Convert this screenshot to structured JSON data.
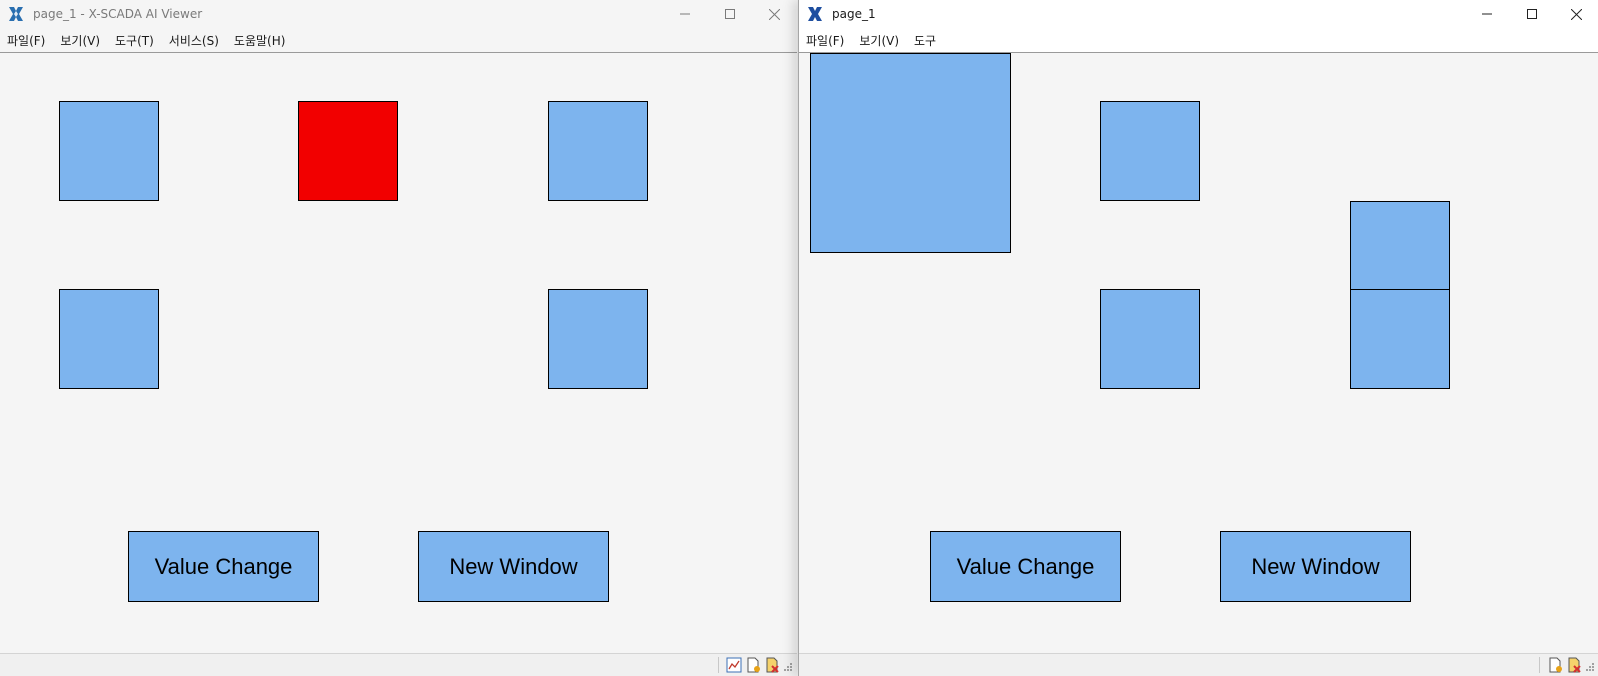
{
  "colors": {
    "shape_fill": "#7db4ee",
    "alarm_fill": "#f20000",
    "border": "#000000"
  },
  "left_window": {
    "title": "page_1 - X-SCADA AI Viewer",
    "menu": [
      "파일(F)",
      "보기(V)",
      "도구(T)",
      "서비스(S)",
      "도움말(H)"
    ],
    "shapes": [
      {
        "name": "shape-1",
        "state": "normal"
      },
      {
        "name": "shape-2",
        "state": "alarm"
      },
      {
        "name": "shape-3",
        "state": "normal"
      },
      {
        "name": "shape-4",
        "state": "normal"
      },
      {
        "name": "shape-5",
        "state": "normal"
      }
    ],
    "buttons": {
      "value_change": "Value Change",
      "new_window": "New Window"
    }
  },
  "right_window": {
    "title": "page_1",
    "menu": [
      "파일(F)",
      "보기(V)",
      "도구"
    ],
    "buttons": {
      "value_change": "Value Change",
      "new_window": "New Window"
    }
  }
}
